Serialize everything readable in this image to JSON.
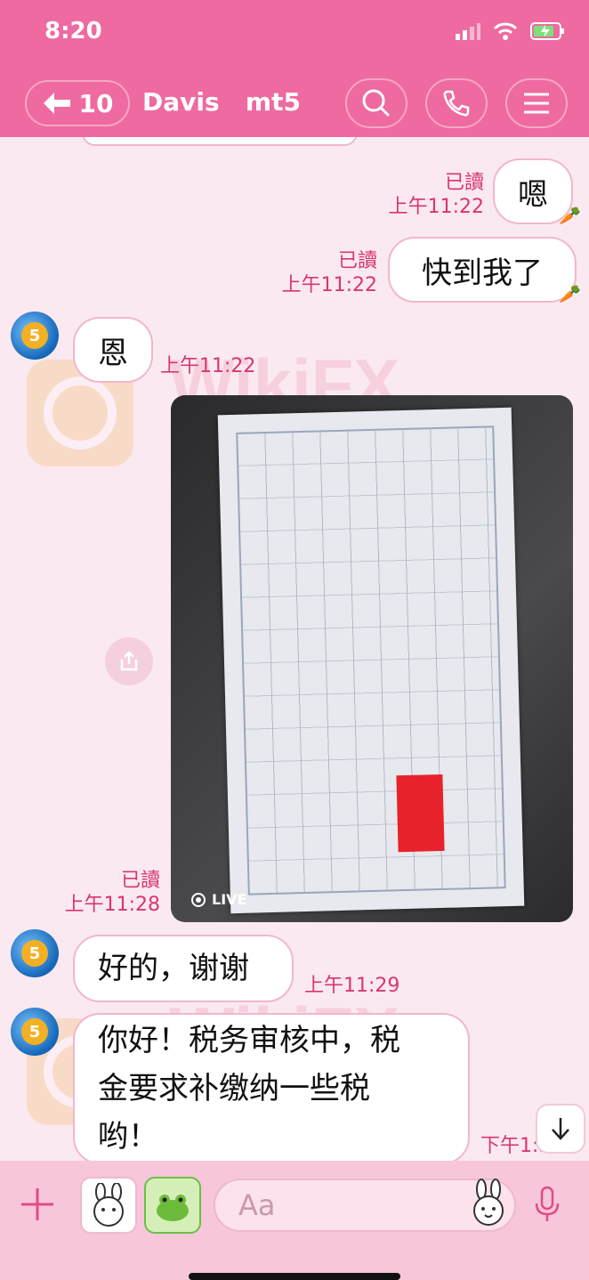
{
  "status": {
    "time": "8:20"
  },
  "header": {
    "back_count": "10",
    "title": "Davis   mt5"
  },
  "messages": {
    "out1": {
      "text": "嗯",
      "read": "已讀",
      "time": "上午11:22"
    },
    "out2": {
      "text": "快到我了",
      "read": "已讀",
      "time": "上午11:22"
    },
    "in1": {
      "text": "恩",
      "time": "上午11:22"
    },
    "photo": {
      "read": "已讀",
      "time": "上午11:28",
      "live": "LIVE"
    },
    "in2": {
      "text": "好的，谢谢",
      "time": "上午11:29"
    },
    "in3": {
      "line1": "你好！税务审核中，税",
      "line2": "金要求补缴纳一些税",
      "line3": "哟！",
      "time": "下午1:32"
    }
  },
  "watermark": "WikiFX",
  "input": {
    "placeholder": "Aa"
  },
  "icons": {
    "back": "arrow-left-icon",
    "search": "search-icon",
    "call": "phone-icon",
    "menu": "menu-icon",
    "share": "share-icon",
    "scroll": "arrow-down-icon",
    "plus": "plus-icon",
    "mic": "mic-icon"
  },
  "colors": {
    "header": "#ee6aa0",
    "accent": "#d8366f",
    "background": "#fbe9f1",
    "input_bar": "#f7c6da"
  }
}
